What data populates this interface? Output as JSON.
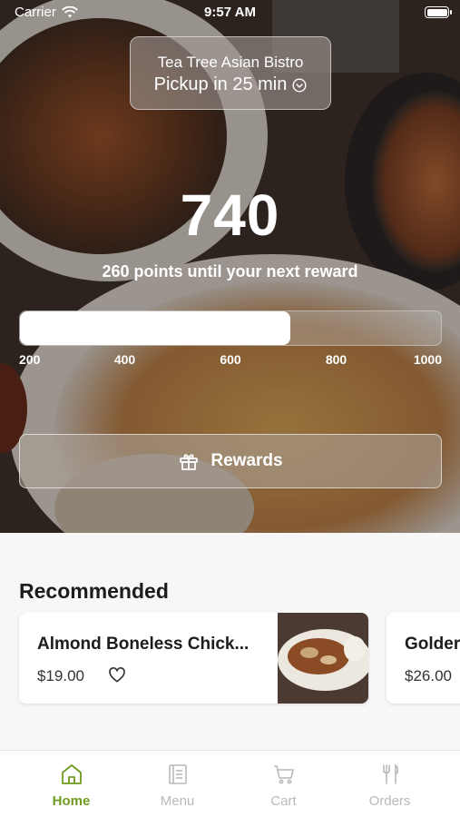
{
  "status_bar": {
    "carrier": "Carrier",
    "time": "9:57 AM"
  },
  "store": {
    "name": "Tea Tree Asian Bistro",
    "pickup": "Pickup in 25 min"
  },
  "rewards": {
    "points": "740",
    "until_next": "260 points until your next reward",
    "progress_value": 740,
    "progress_min": 200,
    "progress_max": 1000,
    "ticks": [
      "200",
      "400",
      "600",
      "800",
      "1000"
    ],
    "button_label": "Rewards"
  },
  "recommended": {
    "title": "Recommended",
    "items": [
      {
        "name": "Almond Boneless Chick...",
        "price": "$19.00"
      },
      {
        "name": "Golder",
        "price": "$26.00"
      }
    ]
  },
  "tabbar": {
    "accent_color": "#6e9b1e",
    "inactive_color": "#b9b9b9",
    "tabs": [
      {
        "label": "Home",
        "icon": "home-icon",
        "active": true
      },
      {
        "label": "Menu",
        "icon": "menu-icon",
        "active": false
      },
      {
        "label": "Cart",
        "icon": "cart-icon",
        "active": false
      },
      {
        "label": "Orders",
        "icon": "utensils-icon",
        "active": false
      }
    ]
  }
}
